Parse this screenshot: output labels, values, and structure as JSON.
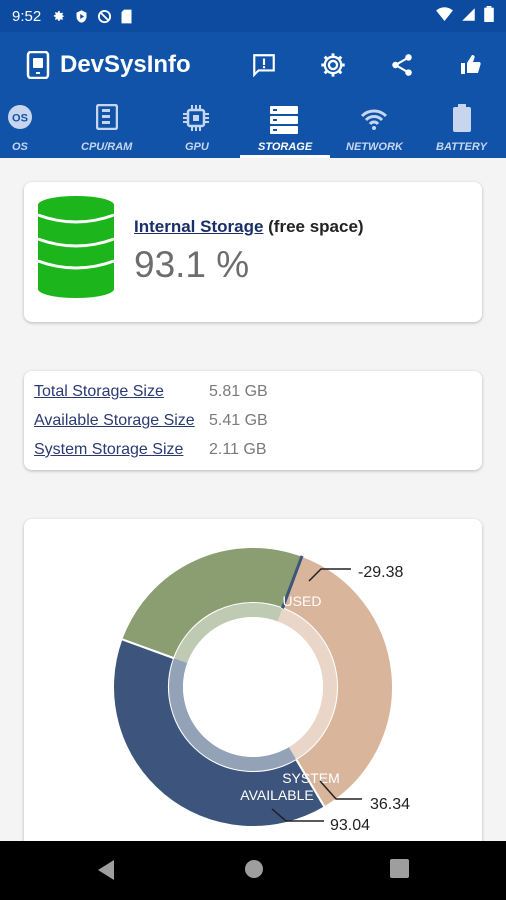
{
  "status_bar": {
    "time": "9:52",
    "icons": [
      "gear-icon",
      "play-protect-icon",
      "vpn-icon",
      "sd-card-icon"
    ],
    "right_icons": [
      "wifi-icon",
      "signal-icon",
      "battery-icon"
    ]
  },
  "app_bar": {
    "title": "DevSysInfo",
    "actions": [
      "feedback-icon",
      "settings-icon",
      "share-icon",
      "thumbs-up-icon"
    ]
  },
  "tabs": [
    {
      "label": "OS",
      "icon": "os-icon",
      "active": false
    },
    {
      "label": "CPU/RAM",
      "icon": "memory-icon",
      "active": false
    },
    {
      "label": "GPU",
      "icon": "chip-icon",
      "active": false
    },
    {
      "label": "STORAGE",
      "icon": "storage-icon",
      "active": true
    },
    {
      "label": "NETWORK",
      "icon": "wifi-icon",
      "active": false
    },
    {
      "label": "BATTERY",
      "icon": "battery-icon",
      "active": false
    }
  ],
  "storage_card": {
    "title_link": "Internal Storage",
    "title_rest": " (free space)",
    "percent": "93.1 %",
    "icon": "database-icon",
    "icon_color": "#1cb51c"
  },
  "details": [
    {
      "key": "Total Storage Size",
      "value": "5.81 GB"
    },
    {
      "key": "Available Storage Size",
      "value": "5.41 GB"
    },
    {
      "key": "System Storage Size",
      "value": "2.11 GB"
    }
  ],
  "chart_data": {
    "type": "pie",
    "variant": "donut",
    "slices": [
      {
        "label": "USED",
        "value_label": "-29.38",
        "color": "#8a9e72",
        "degrees": 90
      },
      {
        "label": "SYSTEM",
        "value_label": "36.34",
        "color": "#d9b59b",
        "degrees": 128
      },
      {
        "label": "AVAILABLE",
        "value_label": "93.04",
        "color": "#3d557d",
        "degrees": 140
      }
    ],
    "separator_color": "#3d557d"
  },
  "nav_bar": [
    "back-icon",
    "home-icon",
    "recents-icon"
  ]
}
